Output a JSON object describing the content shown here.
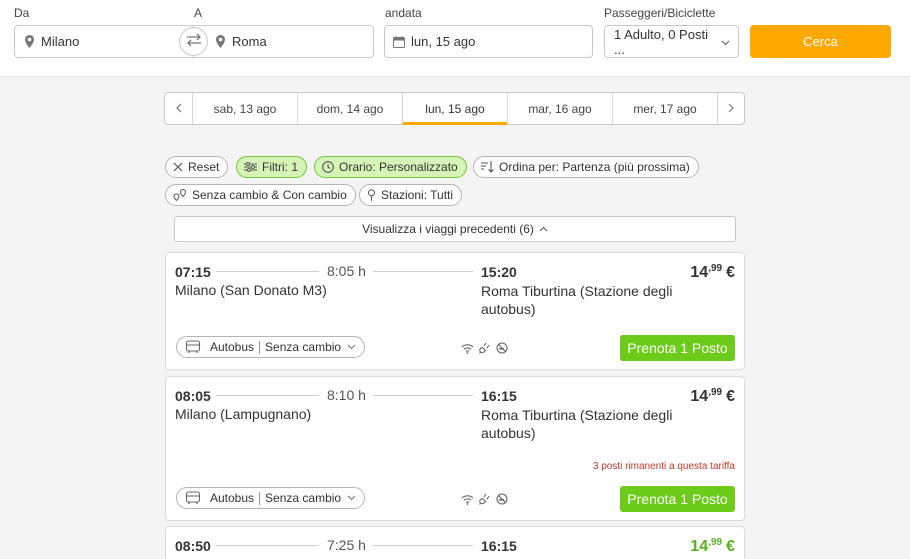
{
  "search": {
    "from_label": "Da",
    "to_label": "A",
    "date_label": "andata",
    "pax_label": "Passeggeri/Biciclette",
    "from_value": "Milano",
    "to_value": "Roma",
    "date_value": "lun, 15 ago",
    "pax_value": "1 Adulto, 0 Posti ...",
    "search_button": "Cerca"
  },
  "dates": {
    "days": [
      "sab, 13 ago",
      "dom, 14 ago",
      "lun, 15 ago",
      "mar, 16 ago",
      "mer, 17 ago"
    ],
    "active_index": 2
  },
  "filters": {
    "reset": "Reset",
    "filters": "Filtri: 1",
    "time": "Orario: Personalizzato",
    "sort": "Ordina per: Partenza (più prossima)",
    "transfers": "Senza cambio & Con cambio",
    "stations": "Stazioni: Tutti"
  },
  "previous_trips": "Visualizza i viaggi precedenti (6)",
  "trips": [
    {
      "dep_time": "07:15",
      "duration": "8:05 h",
      "arr_time": "15:20",
      "dep_station": "Milano (San Donato M3)",
      "arr_station": "Roma Tiburtina (Stazione degli autobus)",
      "price_int": "14",
      "price_dec": ",99",
      "currency": "€",
      "vehicle": "Autobus",
      "transfer": "Senza cambio",
      "book": "Prenota 1 Posto",
      "warning": ""
    },
    {
      "dep_time": "08:05",
      "duration": "8:10 h",
      "arr_time": "16:15",
      "dep_station": "Milano (Lampugnano)",
      "arr_station": "Roma Tiburtina (Stazione degli autobus)",
      "price_int": "14",
      "price_dec": ",99",
      "currency": "€",
      "vehicle": "Autobus",
      "transfer": "Senza cambio",
      "book": "Prenota 1 Posto",
      "warning": "3 posti rimanenti a questa tariffa"
    },
    {
      "dep_time": "08:50",
      "duration": "7:25 h",
      "arr_time": "16:15",
      "dep_station": "",
      "arr_station": "",
      "price_int": "14",
      "price_dec": ",99",
      "currency": "€"
    }
  ],
  "colors": {
    "accent_orange": "#ffa800",
    "book_green": "#6dcc1a",
    "chip_green_bg": "#d4f5b5",
    "warning_red": "#c0392b"
  }
}
